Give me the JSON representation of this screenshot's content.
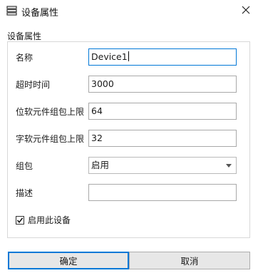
{
  "window": {
    "title": "设备属性",
    "title_icon": "properties-list-icon",
    "close_icon": "close-icon"
  },
  "group": {
    "title": "设备属性"
  },
  "fields": {
    "name_label": "名称",
    "name_value": "Device1",
    "timeout_label": "超时时间",
    "timeout_value": "3000",
    "bit_limit_label": "位软元件组包上限",
    "bit_limit_value": "64",
    "word_limit_label": "字软元件组包上限",
    "word_limit_value": "32",
    "packing_label": "组包",
    "packing_value": "启用",
    "description_label": "描述",
    "description_value": ""
  },
  "enable_device": {
    "label": "启用此设备",
    "checked": true
  },
  "buttons": {
    "ok_label": "确定",
    "cancel_label": "取消"
  },
  "colors": {
    "focus_border": "#0078d7",
    "button_bg": "#e7e7e7"
  }
}
